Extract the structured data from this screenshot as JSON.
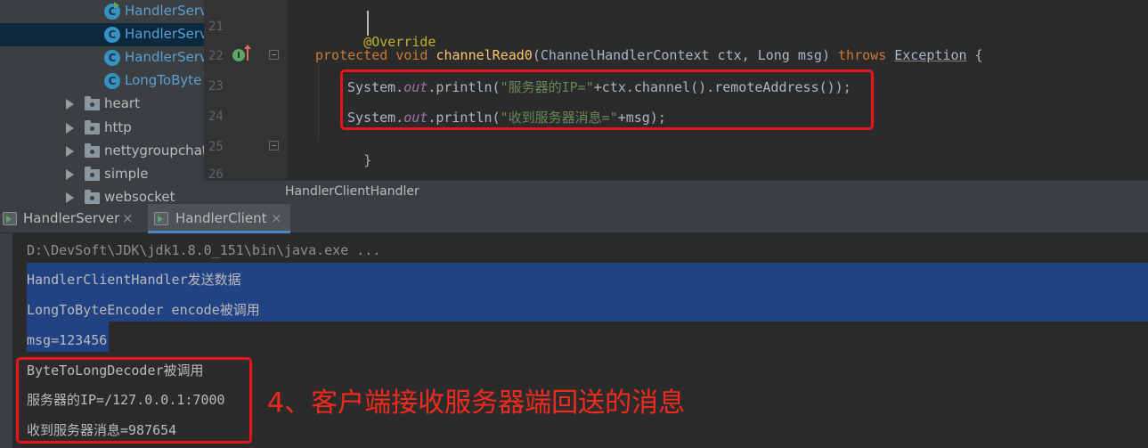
{
  "project_tree": {
    "items": [
      {
        "label": "HandlerServ",
        "kind": "class",
        "icon": "java-class-runnable-icon",
        "selected": false
      },
      {
        "label": "HandlerServ",
        "kind": "class",
        "icon": "java-class-icon",
        "selected": true
      },
      {
        "label": "HandlerServ",
        "kind": "class",
        "icon": "java-class-icon",
        "selected": false
      },
      {
        "label": "LongToByte",
        "kind": "class",
        "icon": "java-class-icon",
        "selected": false
      },
      {
        "label": "heart",
        "kind": "package",
        "icon": "package-folder-icon"
      },
      {
        "label": "http",
        "kind": "package",
        "icon": "package-folder-icon"
      },
      {
        "label": "nettygroupchat",
        "kind": "package",
        "icon": "package-folder-icon"
      },
      {
        "label": "simple",
        "kind": "package",
        "icon": "package-folder-icon"
      },
      {
        "label": "websocket",
        "kind": "package",
        "icon": "package-folder-icon"
      }
    ],
    "class_icon_letter": "C"
  },
  "editor": {
    "line_numbers": [
      "21",
      "22",
      "23",
      "24",
      "25",
      "26"
    ],
    "gutter_marker": "I",
    "lines": {
      "l21": {
        "annotation": "@Override"
      },
      "l22": {
        "kw1": "protected",
        "kw2": "void",
        "method": "channelRead0",
        "params": "(ChannelHandlerContext ctx, Long msg)",
        "throws": "throws",
        "exception": "Exception",
        "brace": " {"
      },
      "l23": {
        "sys": "System.",
        "out": "out",
        "call": ".println(",
        "str": "\"服务器的IP=\"",
        "rest": "+ctx.channel().remoteAddress());"
      },
      "l24": {
        "sys": "System.",
        "out": "out",
        "call": ".println(",
        "str": "\"收到服务器消息=\"",
        "rest": "+msg);"
      },
      "l25": {
        "brace": "}"
      },
      "l26": {
        "brace": "}"
      }
    },
    "breadcrumb": "HandlerClientHandler"
  },
  "run_tabs": [
    {
      "label": "HandlerServer",
      "active": false,
      "close": "×"
    },
    {
      "label": "HandlerClient",
      "active": true,
      "close": "×"
    }
  ],
  "console": {
    "lines": [
      "D:\\DevSoft\\JDK\\jdk1.8.0_151\\bin\\java.exe ...",
      "HandlerClientHandler发送数据",
      "LongToByteEncoder encode被调用",
      "msg=123456",
      "ByteToLongDecoder被调用",
      "服务器的IP=/127.0.0.1:7000",
      "收到服务器消息=987654"
    ]
  },
  "annotation_note": "4、客户端接收服务器端回送的消息",
  "colors": {
    "highlight_box": "#e8141c",
    "annotation_text": "#f22a1d",
    "selection": "#214283"
  }
}
